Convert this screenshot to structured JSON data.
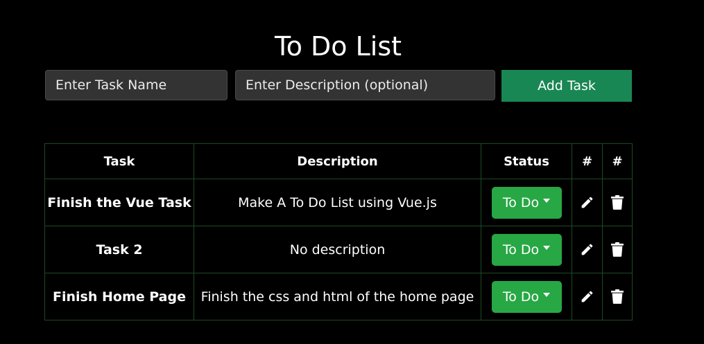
{
  "title": "To Do List",
  "form": {
    "task_placeholder": "Enter Task Name",
    "description_placeholder": "Enter Description (optional)",
    "add_label": "Add Task"
  },
  "table": {
    "headers": [
      "Task",
      "Description",
      "Status",
      "#",
      "#"
    ],
    "rows": [
      {
        "task": "Finish the Vue Task",
        "description": "Make A To Do List using Vue.js",
        "status": "To Do"
      },
      {
        "task": "Task 2",
        "description": "No description",
        "status": "To Do"
      },
      {
        "task": "Finish Home Page",
        "description": "Finish the css and html of the home page",
        "status": "To Do"
      }
    ]
  },
  "icons": {
    "edit": "pencil-icon",
    "delete": "trash-icon",
    "status_dropdown": "caret-down-icon"
  },
  "colors": {
    "background": "#000000",
    "add_button": "#198754",
    "status_button": "#28a745",
    "table_border": "#1d4a24"
  }
}
